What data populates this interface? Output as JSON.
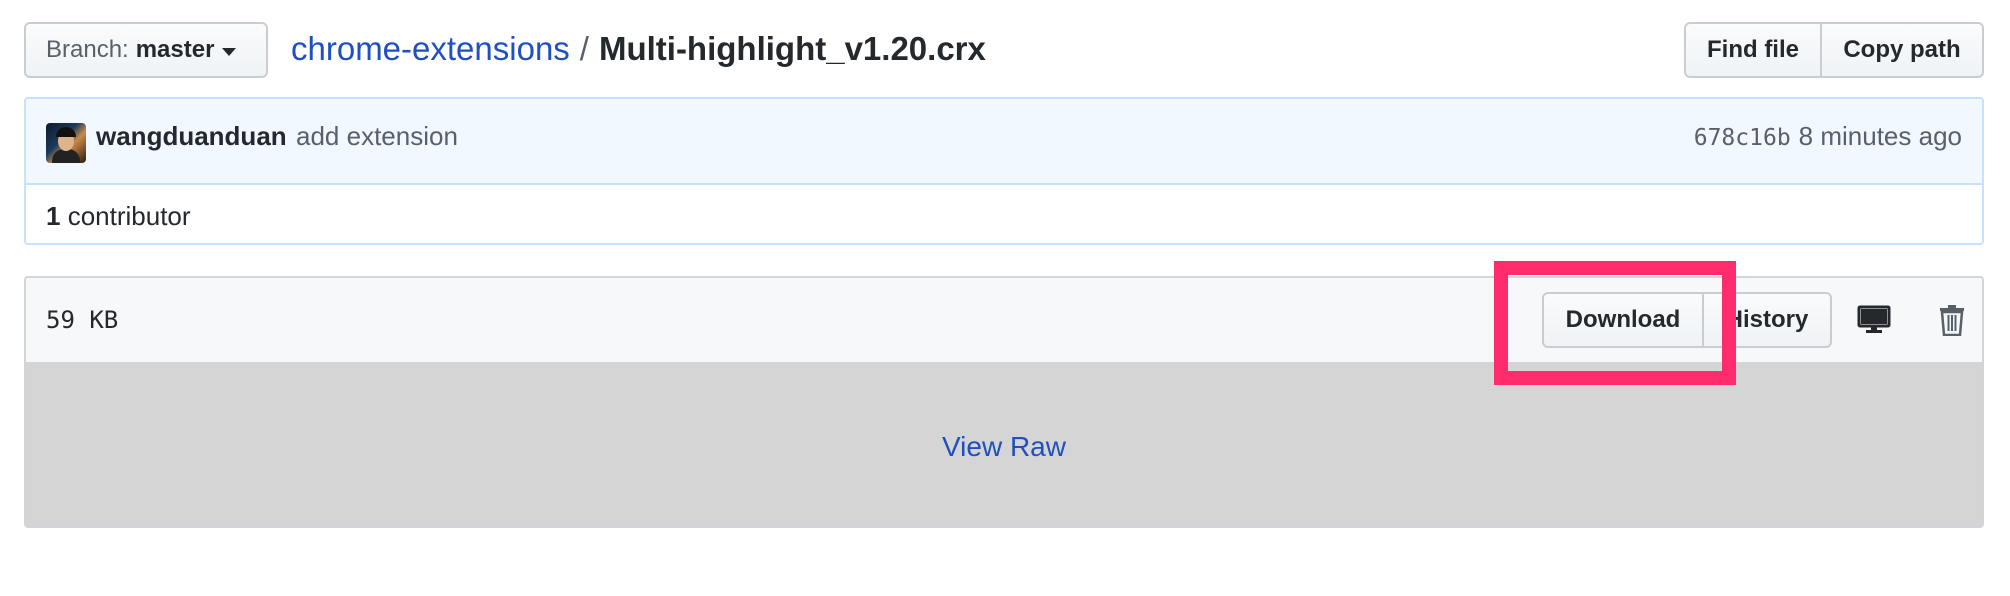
{
  "branch": {
    "label": "Branch:",
    "value": "master"
  },
  "breadcrumb": {
    "repo": "chrome-extensions",
    "separator": "/",
    "file": "Multi-highlight_v1.20.crx"
  },
  "file_actions": {
    "find_file": "Find file",
    "copy_path": "Copy path"
  },
  "commit": {
    "author": "wangduanduan",
    "message": "add extension",
    "sha": "678c16b",
    "time": "8 minutes ago"
  },
  "contributors": {
    "count": "1",
    "label": "contributor"
  },
  "file": {
    "size": "59 KB",
    "download_label": "Download",
    "history_label": "History",
    "view_raw": "View Raw",
    "icons": [
      "desktop-icon",
      "trash-icon"
    ]
  },
  "colors": {
    "link": "#1f4fc1",
    "highlight": "#ff2c6d",
    "commit_bg": "#f1f8ff",
    "raw_bg": "#d5d5d5"
  }
}
